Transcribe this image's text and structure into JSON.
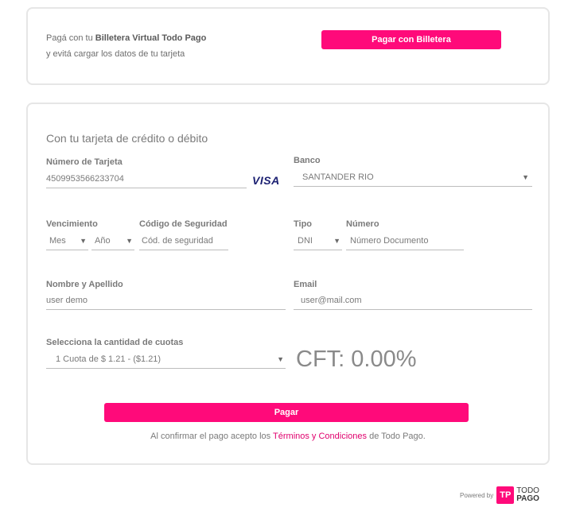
{
  "wallet": {
    "line1_prefix": "Pagá con tu",
    "line1_bold": "Billetera Virtual Todo Pago",
    "line2": "y evitá cargar los datos de tu tarjeta",
    "button": "Pagar con Billetera"
  },
  "form": {
    "title": "Con tu tarjeta de crédito o débito",
    "card_number": {
      "label": "Número de Tarjeta",
      "value": "4509953566233704",
      "brand": "VISA"
    },
    "bank": {
      "label": "Banco",
      "value": "SANTANDER RIO"
    },
    "expiry": {
      "label": "Vencimiento",
      "month": "Mes",
      "year": "Año"
    },
    "security": {
      "label": "Código de Seguridad",
      "placeholder": "Cód. de seguridad"
    },
    "doc_type": {
      "label": "Tipo",
      "value": "DNI"
    },
    "doc_number": {
      "label": "Número",
      "placeholder": "Número Documento"
    },
    "name": {
      "label": "Nombre y Apellido",
      "value": "user demo"
    },
    "email": {
      "label": "Email",
      "value": "user@mail.com"
    },
    "installments": {
      "label": "Selecciona la cantidad de cuotas",
      "value": "1 Cuota de $ 1.21 - ($1.21)"
    },
    "cft": "CFT: 0.00%",
    "pay_button": "Pagar",
    "terms_prefix": "Al confirmar el pago acepto los",
    "terms_link": "Términos y Condiciones",
    "terms_suffix": "de Todo Pago."
  },
  "footer": {
    "powered_by": "Powered by",
    "logo_mark": "TP",
    "logo_line1": "TODO",
    "logo_line2": "PAGO"
  },
  "colors": {
    "accent": "#ff0a7a",
    "link": "#e0006d",
    "visa": "#1a1f71"
  }
}
